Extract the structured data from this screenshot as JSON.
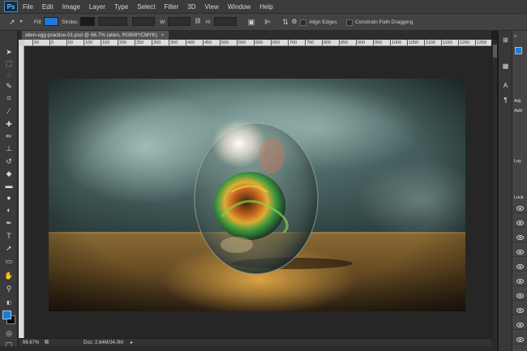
{
  "app": {
    "logo": "Ps"
  },
  "menu": [
    "File",
    "Edit",
    "Image",
    "Layer",
    "Type",
    "Select",
    "Filter",
    "3D",
    "View",
    "Window",
    "Help"
  ],
  "options_bar": {
    "fill_label": "Fill:",
    "stroke_label": "Stroke:",
    "w_label": "W:",
    "h_label": "H:",
    "align_edges_label": "Align Edges",
    "constrain_label": "Constrain Path Dragging",
    "fill_color": "#1f7ad8"
  },
  "document": {
    "tab_title": "alien-egg-practice-01.psd @ 66.7% (alien, RGB/8*/CMYK)",
    "close": "×"
  },
  "ruler": {
    "ticks": [
      "50",
      "0",
      "50",
      "100",
      "150",
      "200",
      "250",
      "300",
      "350",
      "400",
      "450",
      "500",
      "550",
      "600",
      "650",
      "700",
      "750",
      "800",
      "850",
      "900",
      "950",
      "1000",
      "1050",
      "1100",
      "1150",
      "1200",
      "1250",
      "1300"
    ]
  },
  "status": {
    "zoom": "66.67%",
    "doc": "Doc: 2.64M/34.0M"
  },
  "panels": {
    "adjust_title": "Adj",
    "add_title": "Add",
    "layers_title": "Lay",
    "lock_title": "Lock"
  },
  "colors": {
    "foreground": "#1f7ad8",
    "background": "#0a0a0a",
    "ui_dark": "#3a3a3a"
  }
}
